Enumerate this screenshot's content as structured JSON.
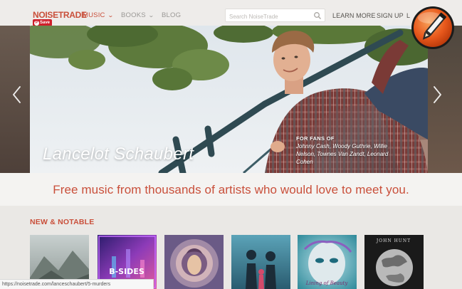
{
  "brand": {
    "logo_text": "NOISETRADE",
    "save_label": "Save"
  },
  "nav": {
    "music": "MUSIC",
    "books": "BOOKS",
    "blog": "BLOG",
    "search_placeholder": "Search NoiseTrade",
    "learn_more": "LEARN MORE",
    "sign_up": "SIGN UP",
    "log_in_partial": "L"
  },
  "hero": {
    "artist_name": "Lancelot Schaubert",
    "fans_title": "FOR FANS OF",
    "fans_list": "Johnny Cash, Woody Guthrie, Willie Nelson, Townes Van Zandt, Leonard Cohen"
  },
  "tagline": "Free music from thousands of artists who would love to meet you.",
  "section": {
    "title": "NEW & NOTABLE"
  },
  "albums": [
    {
      "cover_text": ""
    },
    {
      "cover_text": "B-SIDES"
    },
    {
      "cover_text": ""
    },
    {
      "cover_text": ""
    },
    {
      "cover_text": "Lining of Beauty"
    },
    {
      "cover_text": "JOHN HUNT"
    }
  ],
  "status_url": "https://noisetrade.com/lanceschaubert/5-murders",
  "colors": {
    "accent": "#c94f3a",
    "nav_gray": "#9a9895",
    "pin_red": "#cf1f2b",
    "badge_orange": "#e8581c"
  }
}
